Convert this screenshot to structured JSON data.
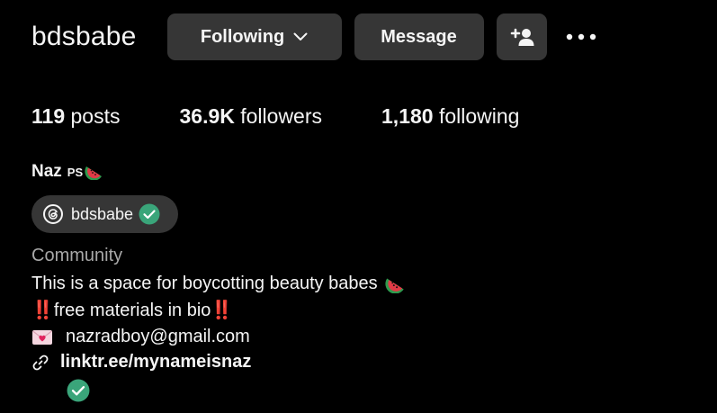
{
  "profile": {
    "username": "bdsbabe",
    "full_name": "Naz",
    "name_suffix": "PS",
    "name_emoji": "watermelon-icon"
  },
  "actions": {
    "following_label": "Following",
    "message_label": "Message",
    "add_user_icon": "add-user-icon",
    "more_icon": "more-options-icon"
  },
  "stats": {
    "posts_count": "119",
    "posts_label": "posts",
    "followers_count": "36.9K",
    "followers_label": "followers",
    "following_count": "1,180",
    "following_label": "following"
  },
  "threads_badge": {
    "handle": "bdsbabe",
    "icon": "threads-icon",
    "verified": true
  },
  "bio": {
    "category": "Community",
    "line1": "This is a space for boycotting beauty babes",
    "line2": "‼️free materials in bio‼️",
    "email": "nazradboy@gmail.com",
    "link": "linktr.ee/mynameisnaz",
    "link_verified": true
  },
  "colors": {
    "background": "#000000",
    "button_bg": "#363636",
    "text": "#f5f5f5",
    "muted_text": "#a8a8a8",
    "verified_green": "#3aa57a",
    "watermelon_red": "#e23a46",
    "watermelon_green": "#2e9b4e"
  }
}
